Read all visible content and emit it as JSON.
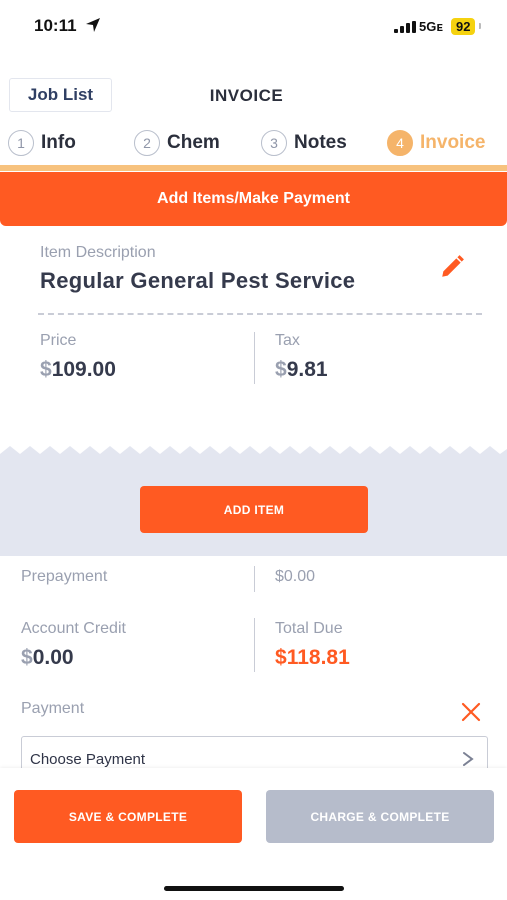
{
  "status_bar": {
    "time": "10:11",
    "network": "5Gᴇ",
    "battery": "92",
    "icons": [
      "location-arrow-icon",
      "signal-bars-icon"
    ]
  },
  "header": {
    "back_label": "Job List",
    "title": "INVOICE"
  },
  "steps": [
    {
      "num": "1",
      "label": "Info"
    },
    {
      "num": "2",
      "label": "Chem"
    },
    {
      "num": "3",
      "label": "Notes"
    },
    {
      "num": "4",
      "label": "Invoice"
    }
  ],
  "banner": {
    "label": "Add Items/Make Payment"
  },
  "item": {
    "description_label": "Item Description",
    "description": "Regular General Pest Service",
    "price_label": "Price",
    "currency": "$",
    "price": "109.00",
    "tax_label": "Tax",
    "tax": "9.81",
    "edit_icon": "pencil-icon"
  },
  "add_item_label": "ADD ITEM",
  "summary": {
    "prepayment_label": "Prepayment",
    "prepayment_value": "$0.00",
    "account_credit_label": "Account Credit",
    "account_credit_value": "0.00",
    "total_due_label": "Total Due",
    "total_due_value": "118.81"
  },
  "payment": {
    "label": "Payment",
    "placeholder": "Choose Payment",
    "clear_icon": "close-icon"
  },
  "actions": {
    "save_label": "SAVE & COMPLETE",
    "charge_label": "CHARGE & COMPLETE"
  },
  "colors": {
    "accent": "#ff5a22",
    "active_step": "#f5b46a",
    "disabled_button": "#b6bccb",
    "band": "#e3e6f0"
  }
}
